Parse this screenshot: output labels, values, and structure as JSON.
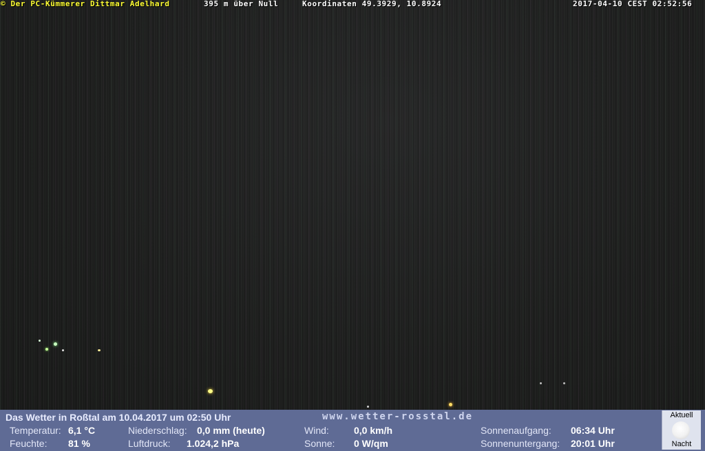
{
  "overlay": {
    "copyright": "© Der PC-Kümmerer Dittmar Adelhard",
    "altitude": "395 m über Null",
    "coordinates": "Koordinaten 49.3929, 10.8924",
    "timestamp": "2017-04-10 CEST 02:52:56"
  },
  "weather": {
    "title": "Das Wetter in Roßtal am 10.04.2017 um 02:50 Uhr",
    "website": "www.wetter-rosstal.de",
    "temperature_label": "Temperatur:",
    "temperature_value": "6,1 °C",
    "humidity_label": "Feuchte:",
    "humidity_value": "81 %",
    "precipitation_label": "Niederschlag:",
    "precipitation_value": "0,0 mm (heute)",
    "pressure_label": "Luftdruck:",
    "pressure_value": "1.024,2 hPa",
    "wind_label": "Wind:",
    "wind_value": "0,0 km/h",
    "sun_label": "Sonne:",
    "sun_value": "0 W/qm",
    "sunrise_label": "Sonnenaufgang:",
    "sunrise_value": "06:34 Uhr",
    "sunset_label": "Sonnenuntergang:",
    "sunset_value": "20:01 Uhr",
    "moon_top": "Aktuell",
    "moon_bottom": "Nacht"
  },
  "colors": {
    "overlay_text": "#ffff33",
    "info_bar": "#5f6b95"
  }
}
